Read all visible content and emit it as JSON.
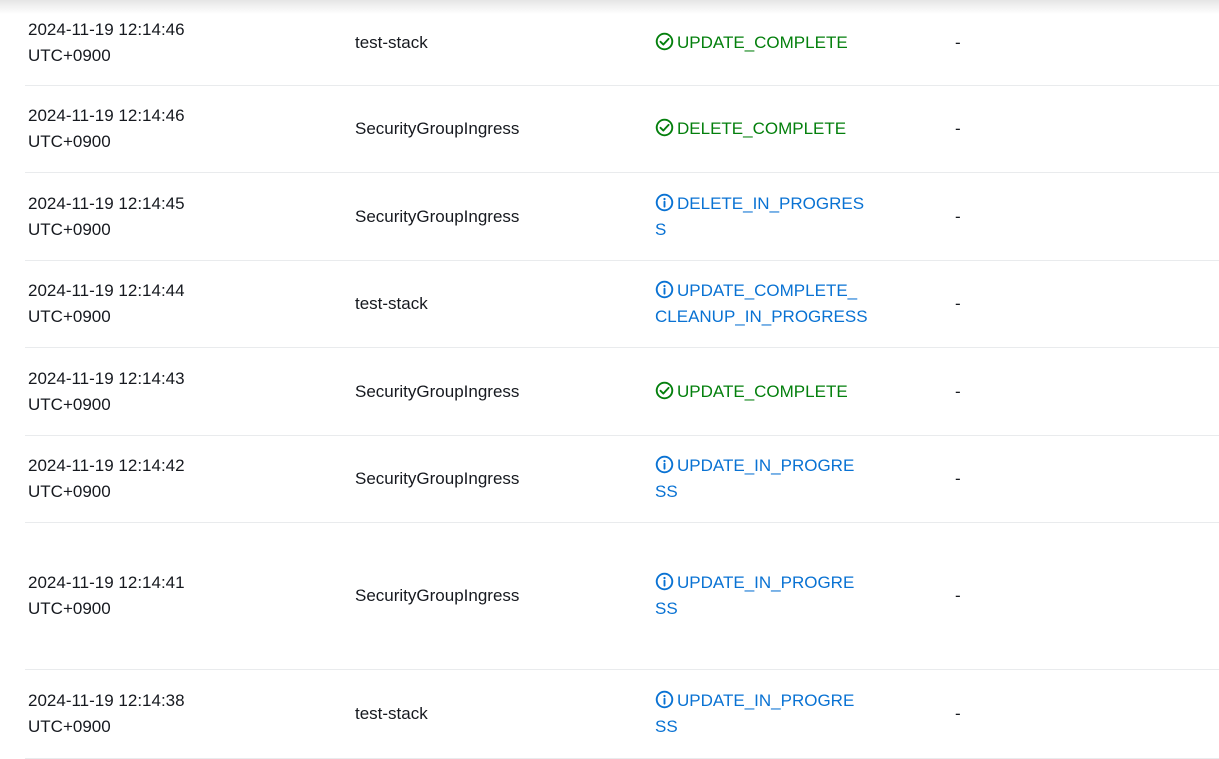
{
  "colors": {
    "success": "#037f0c",
    "info": "#0972d3",
    "text": "#16191f",
    "divider": "#e9ebed"
  },
  "events": [
    {
      "timestamp_date": "2024-11-19 12:14:46",
      "timestamp_tz": "UTC+0900",
      "logical_id": "test-stack",
      "status_line1": "UPDATE_COMPLETE",
      "status_line2": "",
      "status_type": "success",
      "status_icon": "check-circle-icon",
      "reason": "-"
    },
    {
      "timestamp_date": "2024-11-19 12:14:46",
      "timestamp_tz": "UTC+0900",
      "logical_id": "SecurityGroupIngress",
      "status_line1": "DELETE_COMPLETE",
      "status_line2": "",
      "status_type": "success",
      "status_icon": "check-circle-icon",
      "reason": "-"
    },
    {
      "timestamp_date": "2024-11-19 12:14:45",
      "timestamp_tz": "UTC+0900",
      "logical_id": "SecurityGroupIngress",
      "status_line1": "DELETE_IN_PROGRES",
      "status_line2": "S",
      "status_type": "info",
      "status_icon": "info-circle-icon",
      "reason": "-"
    },
    {
      "timestamp_date": "2024-11-19 12:14:44",
      "timestamp_tz": "UTC+0900",
      "logical_id": "test-stack",
      "status_line1": "UPDATE_COMPLETE_",
      "status_line2": "CLEANUP_IN_PROGRESS",
      "status_type": "info",
      "status_icon": "info-circle-icon",
      "reason": "-"
    },
    {
      "timestamp_date": "2024-11-19 12:14:43",
      "timestamp_tz": "UTC+0900",
      "logical_id": "SecurityGroupIngress",
      "status_line1": "UPDATE_COMPLETE",
      "status_line2": "",
      "status_type": "success",
      "status_icon": "check-circle-icon",
      "reason": "-"
    },
    {
      "timestamp_date": "2024-11-19 12:14:42",
      "timestamp_tz": "UTC+0900",
      "logical_id": "SecurityGroupIngress",
      "status_line1": "UPDATE_IN_PROGRE",
      "status_line2": "SS",
      "status_type": "info",
      "status_icon": "info-circle-icon",
      "reason": "-"
    },
    {
      "timestamp_date": "2024-11-19 12:14:41",
      "timestamp_tz": "UTC+0900",
      "logical_id": "SecurityGroupIngress",
      "status_line1": "UPDATE_IN_PROGRE",
      "status_line2": "SS",
      "status_type": "info",
      "status_icon": "info-circle-icon",
      "reason": "-"
    },
    {
      "timestamp_date": "2024-11-19 12:14:38",
      "timestamp_tz": "UTC+0900",
      "logical_id": "test-stack",
      "status_line1": "UPDATE_IN_PROGRE",
      "status_line2": "SS",
      "status_type": "info",
      "status_icon": "info-circle-icon",
      "reason": "-"
    }
  ]
}
